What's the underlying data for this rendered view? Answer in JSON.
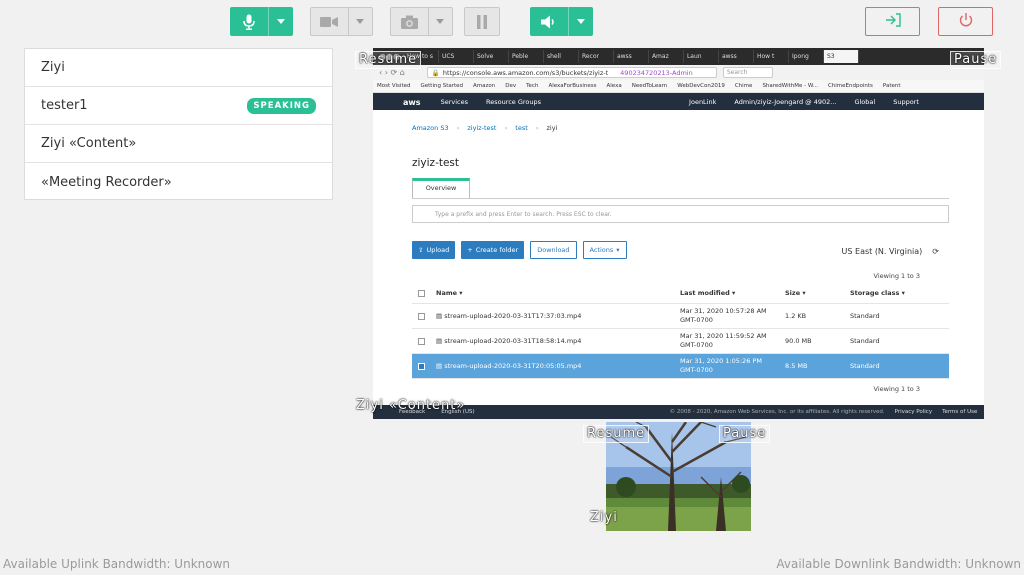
{
  "toolbar": {
    "mic_icon": "microphone-icon",
    "camera_icon": "video-camera-icon",
    "photo_icon": "camera-icon",
    "pause_icon": "pause-icon",
    "speaker_icon": "speaker-icon",
    "share_icon": "exit-icon",
    "power_icon": "power-icon",
    "accent_color": "#2bbf95",
    "danger_color": "#e06666"
  },
  "roster": [
    {
      "name": "Ziyi",
      "badge": ""
    },
    {
      "name": "tester1",
      "badge": "SPEAKING"
    },
    {
      "name": "Ziyi «Content»",
      "badge": ""
    },
    {
      "name": "«Meeting Recorder»",
      "badge": ""
    }
  ],
  "content_tile": {
    "label": "Ziyi «Content»",
    "resume": "Resume",
    "pause": "Pause"
  },
  "video_tile": {
    "label": "Ziyi",
    "resume": "Resume",
    "pause": "Pause"
  },
  "bandwidth": {
    "uplink": "Available Uplink Bandwidth: Unknown",
    "downlink": "Available Downlink Bandwidth: Unknown"
  },
  "shared": {
    "tabs": [
      "How to s",
      "UCS",
      "Solve",
      "Peble",
      "shell",
      "Recor",
      "awss",
      "Amaz",
      "Laun",
      "awss",
      "How t",
      "Ipong",
      "S3"
    ],
    "url": "https://console.aws.amazon.com/s3/buckets/ziyiz-t",
    "url_account": "490234720213-Admin",
    "search_placeholder": "Search",
    "bookmarks": [
      "Most Visited",
      "Getting Started",
      "Amazon",
      "Dev",
      "Tech",
      "AlexaForBusiness",
      "Alexa",
      "NeedToLearn",
      "WebDevCon2019",
      "Chime",
      "SharedWithMe - W...",
      "ChimeEndpoints",
      "Patent"
    ],
    "nav": {
      "services": "Services",
      "resource_groups": "Resource Groups",
      "user": "JoenLink",
      "account": "Admin/ziyiz-Joengard @ 4902...",
      "region": "Global",
      "support": "Support"
    },
    "breadcrumb": [
      "Amazon S3",
      "ziyiz-test",
      "test",
      "ziyi"
    ],
    "bucket_name": "ziyiz-test",
    "tab_overview": "Overview",
    "filter_placeholder": "Type a prefix and press Enter to search. Press ESC to clear.",
    "buttons": {
      "upload": "Upload",
      "create_folder": "Create folder",
      "download": "Download",
      "actions": "Actions"
    },
    "region": "US East (N. Virginia)",
    "viewing": "Viewing 1 to 3",
    "columns": {
      "name": "Name",
      "last_modified": "Last modified",
      "size": "Size",
      "storage_class": "Storage class"
    },
    "files": [
      {
        "name": "stream-upload-2020-03-31T17:37:03.mp4",
        "modified": "Mar 31, 2020 10:57:28 AM",
        "tz": "GMT-0700",
        "size": "1.2 KB",
        "class": "Standard",
        "selected": false
      },
      {
        "name": "stream-upload-2020-03-31T18:58:14.mp4",
        "modified": "Mar 31, 2020 11:59:52 AM",
        "tz": "GMT-0700",
        "size": "90.0 MB",
        "class": "Standard",
        "selected": false
      },
      {
        "name": "stream-upload-2020-03-31T20:05:05.mp4",
        "modified": "Mar 31, 2020 1:05:26 PM",
        "tz": "GMT-0700",
        "size": "8.5 MB",
        "class": "Standard",
        "selected": true
      }
    ],
    "footer": {
      "feedback": "Feedback",
      "language": "English (US)",
      "copyright": "© 2008 - 2020, Amazon Web Services, Inc. or its affiliates. All rights reserved.",
      "privacy": "Privacy Policy",
      "terms": "Terms of Use"
    }
  }
}
